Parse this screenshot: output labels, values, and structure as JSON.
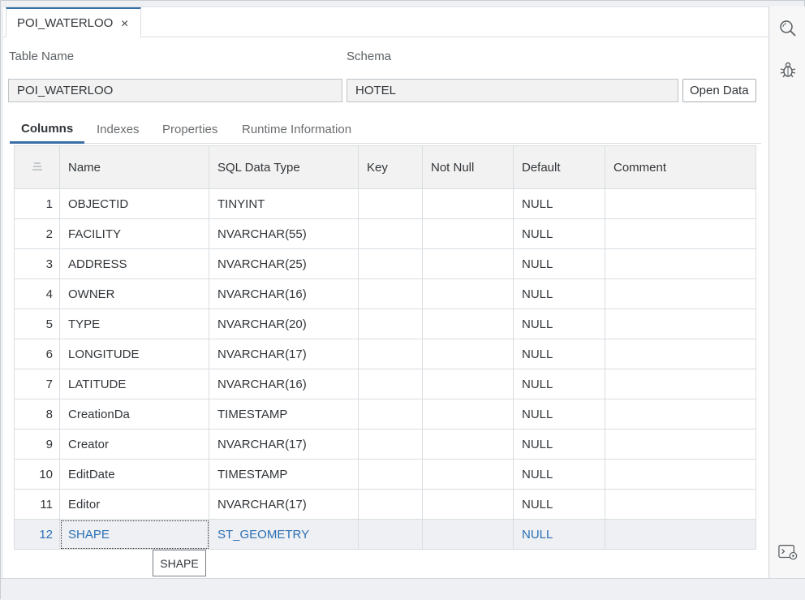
{
  "editor_tab": {
    "title": "POI_WATERLOO",
    "close": "×"
  },
  "form": {
    "table_name_label": "Table Name",
    "table_name_value": "POI_WATERLOO",
    "schema_label": "Schema",
    "schema_value": "HOTEL",
    "open_data_label": "Open Data"
  },
  "tabs": [
    "Columns",
    "Indexes",
    "Properties",
    "Runtime Information"
  ],
  "table": {
    "headers": [
      "Name",
      "SQL Data Type",
      "Key",
      "Not Null",
      "Default",
      "Comment"
    ],
    "rows": [
      {
        "n": "1",
        "name": "OBJECTID",
        "type": "TINYINT",
        "key": "",
        "notnull": "",
        "default": "NULL",
        "comment": ""
      },
      {
        "n": "2",
        "name": "FACILITY",
        "type": "NVARCHAR(55)",
        "key": "",
        "notnull": "",
        "default": "NULL",
        "comment": ""
      },
      {
        "n": "3",
        "name": "ADDRESS",
        "type": "NVARCHAR(25)",
        "key": "",
        "notnull": "",
        "default": "NULL",
        "comment": ""
      },
      {
        "n": "4",
        "name": "OWNER",
        "type": "NVARCHAR(16)",
        "key": "",
        "notnull": "",
        "default": "NULL",
        "comment": ""
      },
      {
        "n": "5",
        "name": "TYPE",
        "type": "NVARCHAR(20)",
        "key": "",
        "notnull": "",
        "default": "NULL",
        "comment": ""
      },
      {
        "n": "6",
        "name": "LONGITUDE",
        "type": "NVARCHAR(17)",
        "key": "",
        "notnull": "",
        "default": "NULL",
        "comment": ""
      },
      {
        "n": "7",
        "name": "LATITUDE",
        "type": "NVARCHAR(16)",
        "key": "",
        "notnull": "",
        "default": "NULL",
        "comment": ""
      },
      {
        "n": "8",
        "name": "CreationDa",
        "type": "TIMESTAMP",
        "key": "",
        "notnull": "",
        "default": "NULL",
        "comment": ""
      },
      {
        "n": "9",
        "name": "Creator",
        "type": "NVARCHAR(17)",
        "key": "",
        "notnull": "",
        "default": "NULL",
        "comment": ""
      },
      {
        "n": "10",
        "name": "EditDate",
        "type": "TIMESTAMP",
        "key": "",
        "notnull": "",
        "default": "NULL",
        "comment": ""
      },
      {
        "n": "11",
        "name": "Editor",
        "type": "NVARCHAR(17)",
        "key": "",
        "notnull": "",
        "default": "NULL",
        "comment": ""
      },
      {
        "n": "12",
        "name": "SHAPE",
        "type": "ST_GEOMETRY",
        "key": "",
        "notnull": "",
        "default": "NULL",
        "comment": ""
      }
    ]
  },
  "tooltip": "SHAPE",
  "icons": {
    "right_top": [
      "search-icon",
      "debug-icon"
    ],
    "right_bottom": "console-icon",
    "sort": "sort-icon"
  },
  "colors": {
    "accent": "#3a6ea5",
    "selected_text": "#2a6fb5"
  }
}
